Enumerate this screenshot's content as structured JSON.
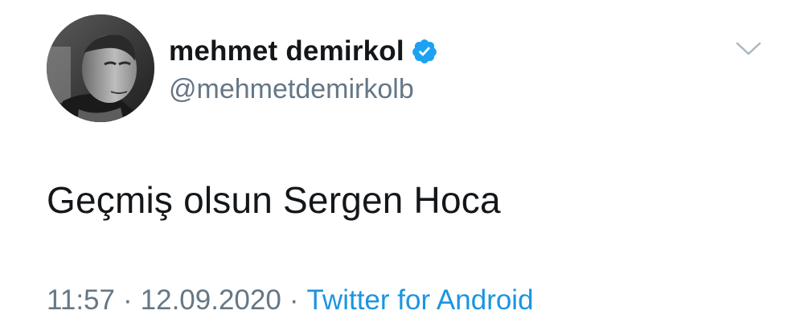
{
  "user": {
    "display_name": "mehmet demirkol",
    "handle": "@mehmetdemirkolb",
    "verified": true
  },
  "tweet": {
    "text": "Geçmiş olsun Sergen Hoca",
    "time": "11:57",
    "separator": "·",
    "date": "12.09.2020",
    "source": "Twitter for Android"
  },
  "icons": {
    "verified": "verified-badge-icon",
    "menu": "chevron-down-icon"
  },
  "colors": {
    "text": "#14171a",
    "secondary": "#657786",
    "link": "#1b95e0",
    "verified": "#1da1f2"
  }
}
